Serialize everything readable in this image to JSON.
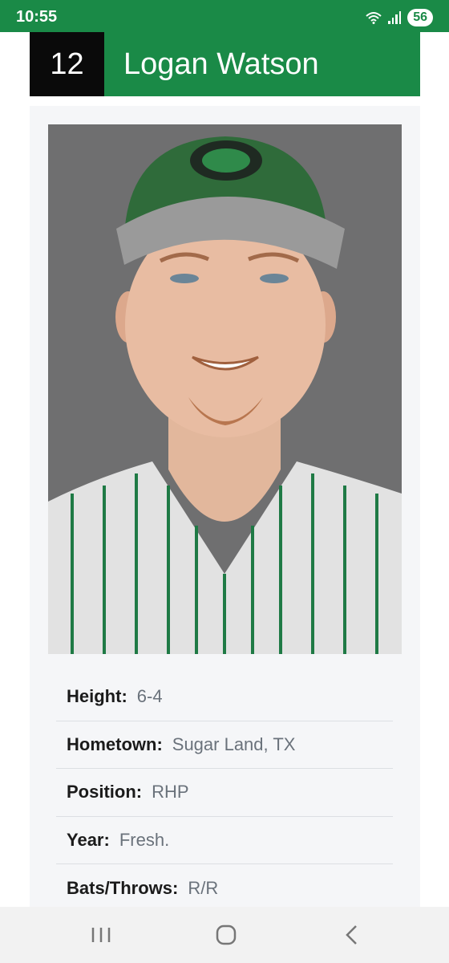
{
  "status_bar": {
    "time": "10:55",
    "battery": "56",
    "icons": [
      "wifi-icon",
      "signal-icon"
    ]
  },
  "player": {
    "number": "12",
    "name": "Logan Watson"
  },
  "photo": {
    "description_icon": "player-photo",
    "colors": {
      "background": "#6f6f70",
      "cap": "#2f6b3a",
      "jersey": "#e4e4e4",
      "pinstripe": "#1f7a45"
    }
  },
  "info": [
    {
      "label": "Height:",
      "value": "6-4"
    },
    {
      "label": "Hometown:",
      "value": "Sugar Land, TX"
    },
    {
      "label": "Position:",
      "value": "RHP"
    },
    {
      "label": "Year:",
      "value": "Fresh."
    },
    {
      "label": "Bats/Throws:",
      "value": "R/R"
    }
  ],
  "nav": {
    "icons": [
      "recent-apps-icon",
      "home-icon",
      "back-icon"
    ]
  },
  "colors": {
    "brand_green": "#1a8a47",
    "number_bg": "#0a0a0a",
    "card_bg": "#f5f6f8"
  }
}
